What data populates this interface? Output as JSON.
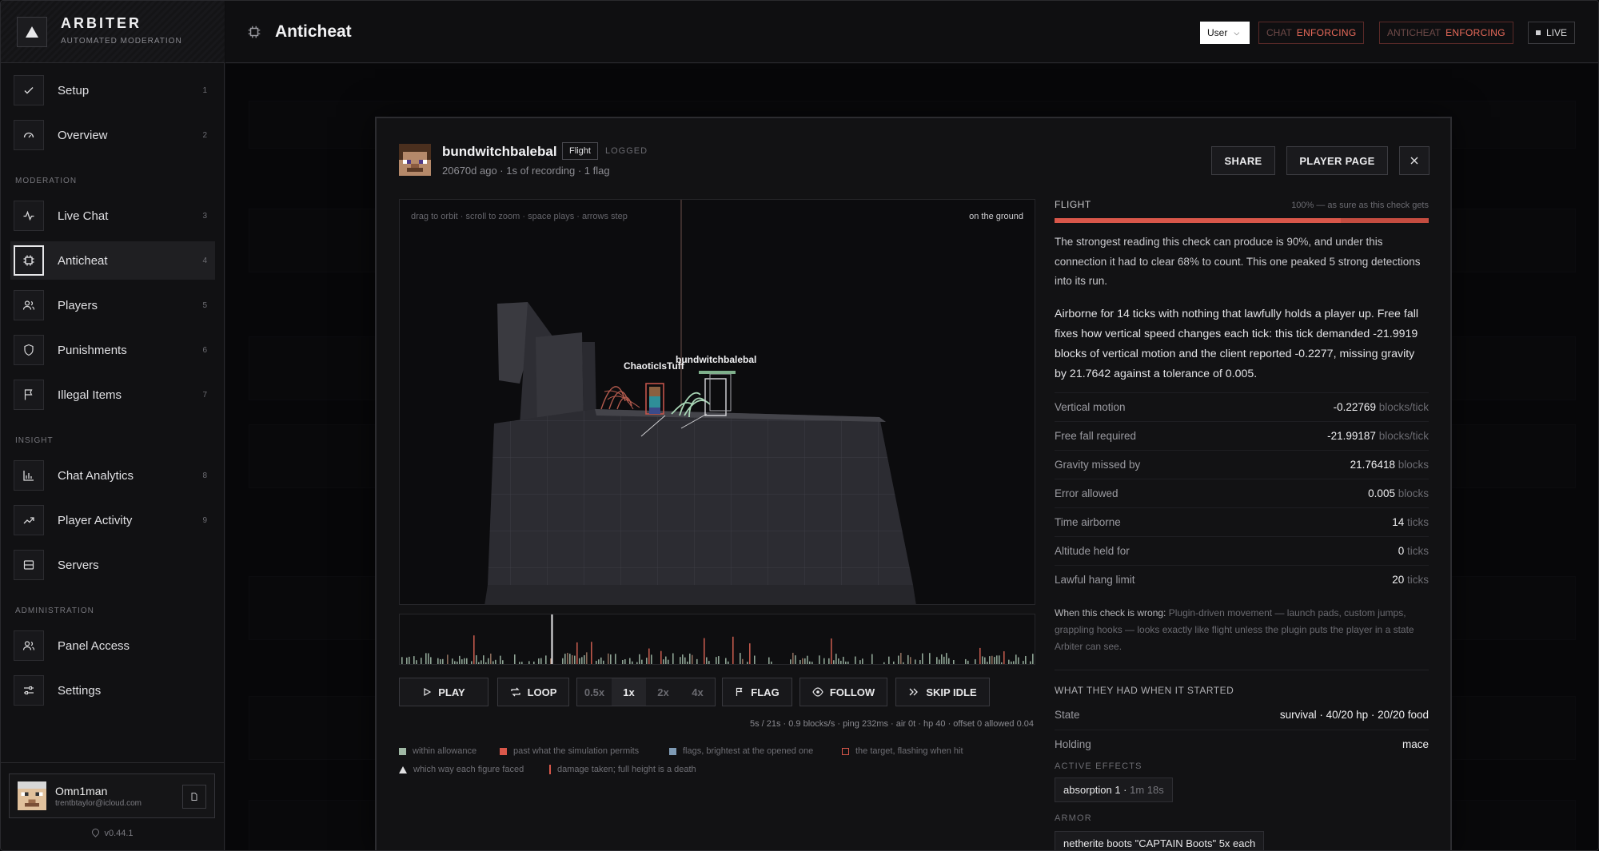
{
  "brand": {
    "name": "ARBITER",
    "subtitle": "AUTOMATED MODERATION"
  },
  "sidebar": {
    "sections": {
      "moderation": "MODERATION",
      "insight": "INSIGHT",
      "administration": "ADMINISTRATION"
    },
    "items": [
      {
        "label": "Setup",
        "num": "1",
        "icon": "check-icon"
      },
      {
        "label": "Overview",
        "num": "2",
        "icon": "gauge-icon"
      },
      {
        "label": "Live Chat",
        "num": "3",
        "icon": "pulse-icon"
      },
      {
        "label": "Anticheat",
        "num": "4",
        "icon": "chip-icon"
      },
      {
        "label": "Players",
        "num": "5",
        "icon": "users-icon"
      },
      {
        "label": "Punishments",
        "num": "6",
        "icon": "shield-icon"
      },
      {
        "label": "Illegal Items",
        "num": "7",
        "icon": "flag-icon"
      },
      {
        "label": "Chat Analytics",
        "num": "8",
        "icon": "bar-chart-icon"
      },
      {
        "label": "Player Activity",
        "num": "9",
        "icon": "trend-icon"
      },
      {
        "label": "Servers",
        "num": "",
        "icon": "server-icon"
      },
      {
        "label": "Panel Access",
        "num": "",
        "icon": "users-icon"
      },
      {
        "label": "Settings",
        "num": "",
        "icon": "sliders-icon"
      }
    ],
    "user": {
      "name": "Omn1man",
      "email": "trentbtaylor@icloud.com"
    },
    "version": "v0.44.1"
  },
  "header": {
    "title": "Anticheat",
    "role_select": "User",
    "chat_label": "CHAT",
    "chat_status": "ENFORCING",
    "anticheat_label": "ANTICHEAT",
    "anticheat_status": "ENFORCING",
    "live_label": "LIVE"
  },
  "modal": {
    "player": "bundwitchbalebal",
    "check_badge": "Flight",
    "logged": "LOGGED",
    "meta": "20670d ago · 1s of recording · 1 flag",
    "share": "SHARE",
    "player_page": "PLAYER PAGE",
    "viewport": {
      "hint": "drag to orbit · scroll to zoom · space plays · arrows step",
      "state": "on the ground",
      "label_other": "ChaoticIsTuff",
      "label_target": "bundwitchbalebal"
    },
    "controls": {
      "play": "PLAY",
      "loop": "LOOP",
      "speeds": [
        "0.5x",
        "1x",
        "2x",
        "4x"
      ],
      "speed_selected": "1x",
      "flag": "FLAG",
      "follow": "FOLLOW",
      "skip_idle": "SKIP IDLE"
    },
    "stats_line": "5s / 21s · 0.9 blocks/s · ping 232ms · air 0t · hp 40 · offset 0 allowed 0.04",
    "legend": {
      "within": "within allowance",
      "past": "past what the simulation permits",
      "flags": "flags, brightest at the opened one",
      "target": "the target, flashing when hit",
      "facing": "which way each figure faced",
      "damage": "damage taken; full height is a death"
    },
    "timeline_progress": 0.238,
    "check": {
      "name": "FLIGHT",
      "confidence": "100% — as sure as this check gets",
      "confidence_value": 1.0,
      "summary": "The strongest reading this check can produce is 90%, and under this connection it had to clear 68% to count. This one peaked 5 strong detections into its run.",
      "explanation": "Airborne for 14 ticks with nothing that lawfully holds a player up. Free fall fixes how vertical speed changes each tick: this tick demanded -21.9919 blocks of vertical motion and the client reported -0.2277, missing gravity by 21.7642 against a tolerance of 0.005.",
      "rows": [
        {
          "k": "Vertical motion",
          "v": "-0.22769",
          "u": "blocks/tick"
        },
        {
          "k": "Free fall required",
          "v": "-21.99187",
          "u": "blocks/tick"
        },
        {
          "k": "Gravity missed by",
          "v": "21.76418",
          "u": "blocks"
        },
        {
          "k": "Error allowed",
          "v": "0.005",
          "u": "blocks"
        },
        {
          "k": "Time airborne",
          "v": "14",
          "u": "ticks"
        },
        {
          "k": "Altitude held for",
          "v": "0",
          "u": "ticks"
        },
        {
          "k": "Lawful hang limit",
          "v": "20",
          "u": "ticks"
        }
      ],
      "wrong_label": "When this check is wrong:",
      "wrong_text": "Plugin-driven movement — launch pads, custom jumps, grappling hooks — looks exactly like flight unless the plugin puts the player in a state Arbiter can see."
    },
    "started": {
      "heading": "WHAT THEY HAD WHEN IT STARTED",
      "state_label": "State",
      "state_value": "survival · 40/20 hp · 20/20 food",
      "holding_label": "Holding",
      "holding_value": "mace",
      "effects_heading": "ACTIVE EFFECTS",
      "effect_name": "absorption 1",
      "effect_time": "1m 18s",
      "armor_heading": "ARMOR",
      "armor_item": "netherite boots \"CAPTAIN Boots\" 5x each"
    }
  },
  "colors": {
    "accent_red": "#d9574a",
    "enforcing": "#e86a5a",
    "within": "#9fb8a4",
    "past": "#d9574a",
    "flags": "#7f9bb5"
  }
}
